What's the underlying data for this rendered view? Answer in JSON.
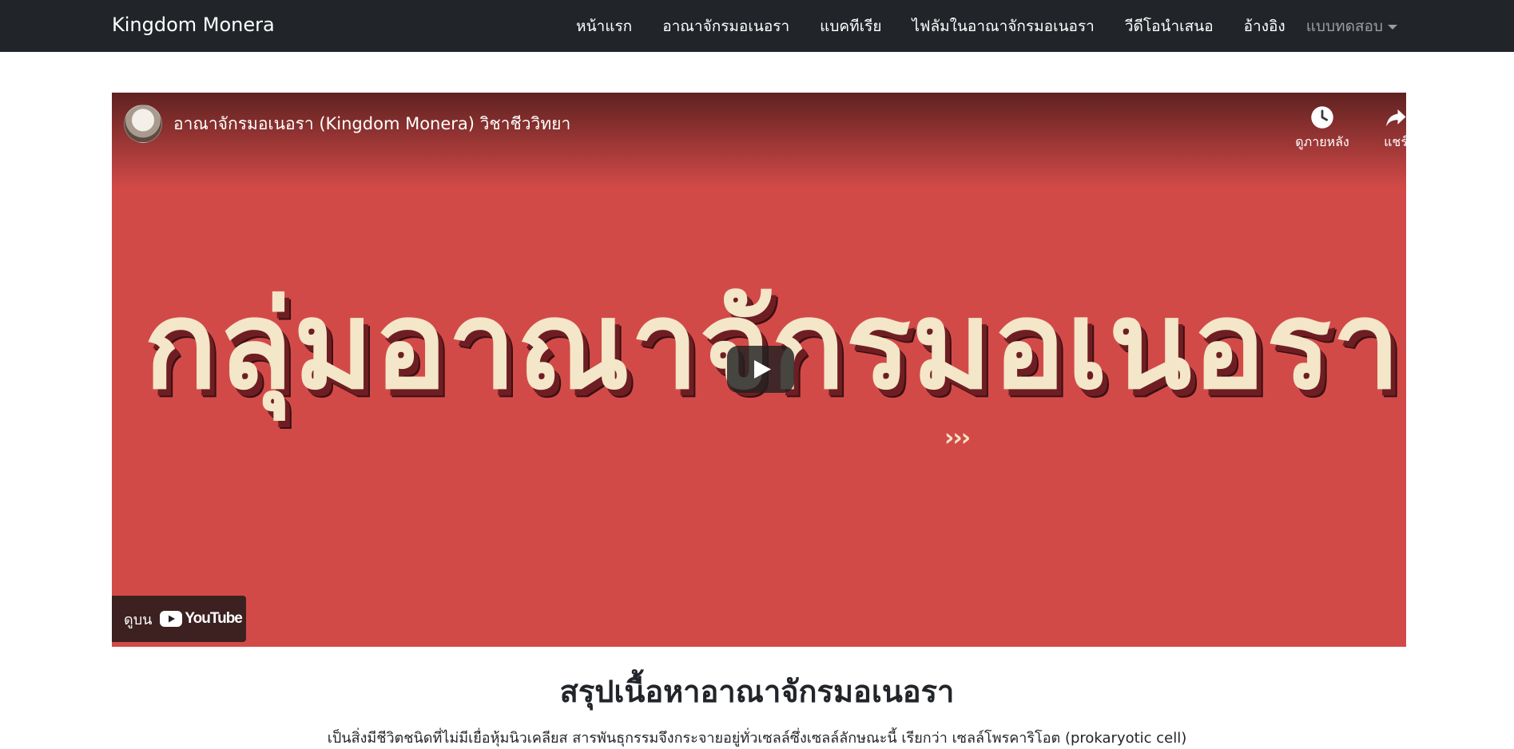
{
  "navbar": {
    "brand": "Kingdom Monera",
    "items": [
      {
        "label": "หน้าแรก"
      },
      {
        "label": "อาณาจักรมอเนอรา"
      },
      {
        "label": "แบคทีเรีย"
      },
      {
        "label": "ไฟลัมในอาณาจักรมอเนอรา"
      },
      {
        "label": "วีดีโอนำเสนอ"
      },
      {
        "label": "อ้างอิง"
      }
    ],
    "dropdown_label": "แบบทดสอบ"
  },
  "video": {
    "title": "อาณาจักรมอเนอรา (Kingdom Monera) วิชาชีววิทยา",
    "thumbnail_text": "กลุ่มอาณาจักรมอเนอรา",
    "thumbnail_chevrons": "›››",
    "watch_later_label": "ดูภายหลัง",
    "share_label": "แชร์",
    "watch_on_label": "ดูบน",
    "youtube_wordmark": "YouTube",
    "background_color": "#d24a48"
  },
  "content": {
    "heading": "สรุปเนื้อหาอาณาจักรมอเนอรา",
    "paragraph": "เป็นสิ่งมีชีวิตชนิดที่ไม่มีเยื่อหุ้มนิวเคลียส สารพันธุกรรมจึงกระจายอยู่ทั่วเซลล์ซึ่งเซลล์ลักษณะนี้ เรียกว่า เซลล์โพรคาริโอต (prokaryotic cell)"
  },
  "icons": {
    "watch_later": "clock-icon",
    "share": "share-arrow-icon",
    "play": "play-icon",
    "dropdown": "caret-down-icon",
    "youtube": "youtube-logo-icon"
  }
}
